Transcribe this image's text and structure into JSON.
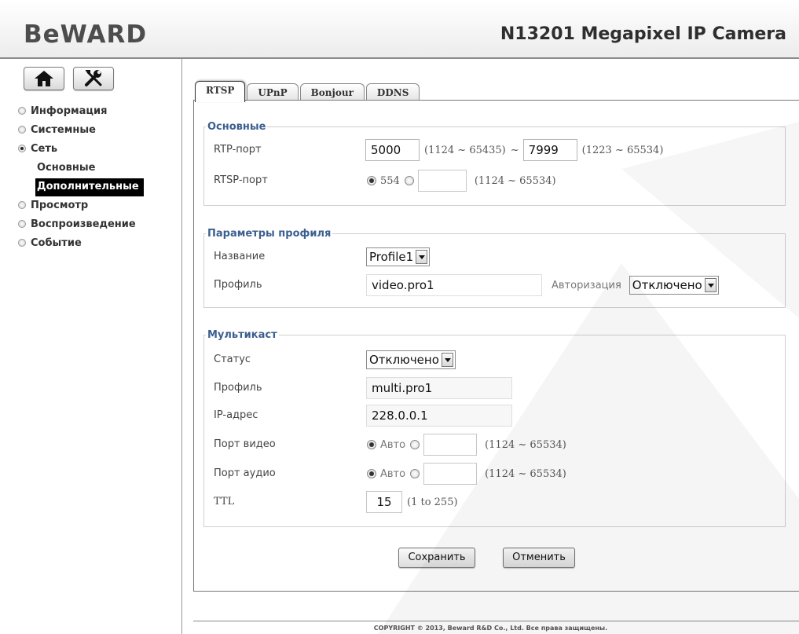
{
  "header": {
    "logo": "BeWARD",
    "model": "N13201 Megapixel IP Camera"
  },
  "sidebar": {
    "items": [
      {
        "label": "Информация",
        "selected": false
      },
      {
        "label": "Системные",
        "selected": false
      },
      {
        "label": "Сеть",
        "selected": true
      },
      {
        "label": "Просмотр",
        "selected": false
      },
      {
        "label": "Воспроизведение",
        "selected": false
      },
      {
        "label": "Событие",
        "selected": false
      }
    ],
    "subitems": [
      {
        "label": "Основные",
        "active": false
      },
      {
        "label": "Дополнительные",
        "active": true
      }
    ]
  },
  "tabs": [
    "RTSP",
    "UPnP",
    "Bonjour",
    "DDNS"
  ],
  "basic": {
    "legend": "Основные",
    "rtp_label": "RTP-порт",
    "rtp_from": "5000",
    "rtp_from_range": "(1124 ~ 65435)",
    "tilde": "~",
    "rtp_to": "7999",
    "rtp_to_range": "(1223 ~ 65534)",
    "rtsp_label": "RTSP-порт",
    "rtsp_default": "554",
    "rtsp_custom": "",
    "rtsp_range": "(1124 ~ 65534)"
  },
  "profile": {
    "legend": "Параметры профиля",
    "name_label": "Название",
    "name_value": "Profile1",
    "profile_label": "Профиль",
    "profile_value": "video.pro1",
    "auth_label": "Авторизация",
    "auth_value": "Отключено"
  },
  "multicast": {
    "legend": "Мультикаст",
    "status_label": "Статус",
    "status_value": "Отключено",
    "profile_label": "Профиль",
    "profile_value": "multi.pro1",
    "ip_label": "IP-адрес",
    "ip_value": "228.0.0.1",
    "video_label": "Порт видео",
    "video_auto": "Авто",
    "video_range": "(1124 ~ 65534)",
    "audio_label": "Порт аудио",
    "audio_auto": "Авто",
    "audio_range": "(1124 ~ 65534)",
    "ttl_label": "TTL",
    "ttl_value": "15",
    "ttl_range": "(1 to 255)"
  },
  "buttons": {
    "save": "Сохранить",
    "cancel": "Отменить"
  },
  "footer": "COPYRIGHT © 2013, Beward R&D Co., Ltd. Все права защищены."
}
